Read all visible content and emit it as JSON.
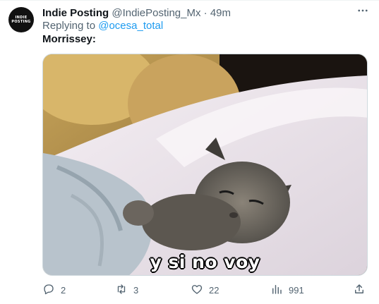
{
  "tweet": {
    "avatar": {
      "line1": "INDIE",
      "line2": "POSTING"
    },
    "author_name": "Indie Posting",
    "author_handle": "@IndiePosting_Mx",
    "separator": "·",
    "time": "49m",
    "replying_prefix": "Replying to",
    "replying_to": "@ocesa_total",
    "text": "Morrissey:",
    "media": {
      "caption": "y si no voy"
    },
    "actions": {
      "replies": "2",
      "retweets": "3",
      "likes": "22",
      "views": "991"
    },
    "icons": {
      "more": "more-horizontal-icon",
      "reply": "reply-icon",
      "retweet": "retweet-icon",
      "like": "heart-icon",
      "views": "views-bar-chart-icon",
      "share": "share-icon"
    },
    "colors": {
      "text": "#0f1419",
      "secondary": "#536471",
      "link": "#1d9bf0",
      "border": "#cfd9de"
    }
  }
}
